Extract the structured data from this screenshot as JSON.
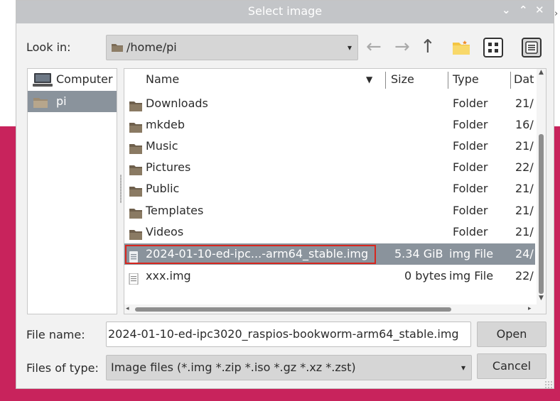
{
  "dialog": {
    "title": "Select image",
    "title_controls": [
      "⌄",
      "⌃",
      "✕"
    ]
  },
  "toolbar": {
    "look_in_label": "Look in:",
    "path": "/home/pi",
    "nav_back_glyph": "←",
    "nav_forward_glyph": "→",
    "nav_up_glyph": "↑",
    "icons": [
      "folder-new-icon",
      "icon-view-icon",
      "list-view-icon"
    ]
  },
  "sidebar": {
    "items": [
      {
        "label": "Computer",
        "icon": "computer-icon",
        "selected": false
      },
      {
        "label": "pi",
        "icon": "folder-icon",
        "selected": true
      }
    ]
  },
  "file_list": {
    "columns": [
      "Name",
      "Size",
      "Type",
      "Dat"
    ],
    "rows": [
      {
        "name": "Downloads",
        "size": "",
        "type": "Folder",
        "date": "21/",
        "icon": "folder-icon"
      },
      {
        "name": "mkdeb",
        "size": "",
        "type": "Folder",
        "date": "16/",
        "icon": "folder-icon"
      },
      {
        "name": "Music",
        "size": "",
        "type": "Folder",
        "date": "21/",
        "icon": "folder-icon"
      },
      {
        "name": "Pictures",
        "size": "",
        "type": "Folder",
        "date": "22/",
        "icon": "folder-icon"
      },
      {
        "name": "Public",
        "size": "",
        "type": "Folder",
        "date": "21/",
        "icon": "folder-icon"
      },
      {
        "name": "Templates",
        "size": "",
        "type": "Folder",
        "date": "21/",
        "icon": "folder-icon"
      },
      {
        "name": "Videos",
        "size": "",
        "type": "Folder",
        "date": "21/",
        "icon": "folder-icon"
      },
      {
        "name": "2024-01-10-ed-ipc...-arm64_stable.img",
        "size": "5.34 GiB",
        "type": "img File",
        "date": "24/",
        "icon": "file-icon",
        "selected": true
      },
      {
        "name": "xxx.img",
        "size": "0 bytes",
        "type": "img File",
        "date": "22/",
        "icon": "file-icon"
      }
    ]
  },
  "footer": {
    "file_name_label": "File name:",
    "file_name_value": "2024-01-10-ed-ipc3020_raspios-bookworm-arm64_stable.img",
    "file_type_label": "Files of type:",
    "file_type_value": "Image files (*.img *.zip *.iso *.gz *.xz *.zst)",
    "open_label": "Open",
    "cancel_label": "Cancel"
  },
  "colors": {
    "accent_background": "#c8235c",
    "selection": "#8a939c",
    "highlight_box": "#d7261e",
    "titlebar": "#c3c5c8",
    "folder": "#7a6a55"
  }
}
